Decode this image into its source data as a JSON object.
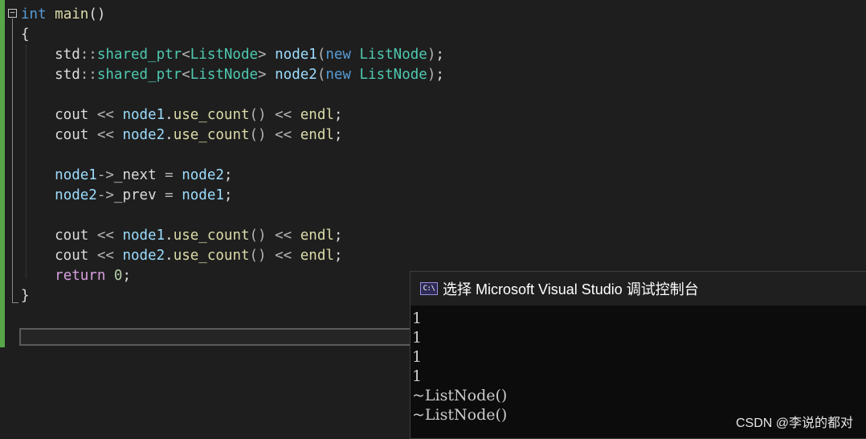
{
  "editor": {
    "lines": [
      [
        [
          "kw",
          "int"
        ],
        [
          "plain",
          " "
        ],
        [
          "fn",
          "main"
        ],
        [
          "plain",
          "()"
        ]
      ],
      [
        [
          "plain",
          "{"
        ]
      ],
      [
        [
          "plain",
          "    std"
        ],
        [
          "op",
          "::"
        ],
        [
          "ty",
          "shared_ptr"
        ],
        [
          "op",
          "<"
        ],
        [
          "ty",
          "ListNode"
        ],
        [
          "op",
          "> "
        ],
        [
          "var",
          "node1"
        ],
        [
          "op",
          "("
        ],
        [
          "kw",
          "new"
        ],
        [
          "plain",
          " "
        ],
        [
          "ty",
          "ListNode"
        ],
        [
          "op",
          ")"
        ],
        [
          "plain",
          ";"
        ]
      ],
      [
        [
          "plain",
          "    std"
        ],
        [
          "op",
          "::"
        ],
        [
          "ty",
          "shared_ptr"
        ],
        [
          "op",
          "<"
        ],
        [
          "ty",
          "ListNode"
        ],
        [
          "op",
          "> "
        ],
        [
          "var",
          "node2"
        ],
        [
          "op",
          "("
        ],
        [
          "kw",
          "new"
        ],
        [
          "plain",
          " "
        ],
        [
          "ty",
          "ListNode"
        ],
        [
          "op",
          ")"
        ],
        [
          "plain",
          ";"
        ]
      ],
      [],
      [
        [
          "plain",
          "    cout "
        ],
        [
          "op",
          "<<"
        ],
        [
          "plain",
          " "
        ],
        [
          "var",
          "node1"
        ],
        [
          "plain",
          "."
        ],
        [
          "fn",
          "use_count"
        ],
        [
          "op",
          "()"
        ],
        [
          "plain",
          " "
        ],
        [
          "op",
          "<<"
        ],
        [
          "plain",
          " "
        ],
        [
          "fn",
          "endl"
        ],
        [
          "plain",
          ";"
        ]
      ],
      [
        [
          "plain",
          "    cout "
        ],
        [
          "op",
          "<<"
        ],
        [
          "plain",
          " "
        ],
        [
          "var",
          "node2"
        ],
        [
          "plain",
          "."
        ],
        [
          "fn",
          "use_count"
        ],
        [
          "op",
          "()"
        ],
        [
          "plain",
          " "
        ],
        [
          "op",
          "<<"
        ],
        [
          "plain",
          " "
        ],
        [
          "fn",
          "endl"
        ],
        [
          "plain",
          ";"
        ]
      ],
      [],
      [
        [
          "plain",
          "    "
        ],
        [
          "var",
          "node1"
        ],
        [
          "op",
          "->"
        ],
        [
          "plain",
          "_next "
        ],
        [
          "op",
          "="
        ],
        [
          "plain",
          " "
        ],
        [
          "var",
          "node2"
        ],
        [
          "plain",
          ";"
        ]
      ],
      [
        [
          "plain",
          "    "
        ],
        [
          "var",
          "node2"
        ],
        [
          "op",
          "->"
        ],
        [
          "plain",
          "_prev "
        ],
        [
          "op",
          "="
        ],
        [
          "plain",
          " "
        ],
        [
          "var",
          "node1"
        ],
        [
          "plain",
          ";"
        ]
      ],
      [],
      [
        [
          "plain",
          "    cout "
        ],
        [
          "op",
          "<<"
        ],
        [
          "plain",
          " "
        ],
        [
          "var",
          "node1"
        ],
        [
          "plain",
          "."
        ],
        [
          "fn",
          "use_count"
        ],
        [
          "op",
          "()"
        ],
        [
          "plain",
          " "
        ],
        [
          "op",
          "<<"
        ],
        [
          "plain",
          " "
        ],
        [
          "fn",
          "endl"
        ],
        [
          "plain",
          ";"
        ]
      ],
      [
        [
          "plain",
          "    cout "
        ],
        [
          "op",
          "<<"
        ],
        [
          "plain",
          " "
        ],
        [
          "var",
          "node2"
        ],
        [
          "plain",
          "."
        ],
        [
          "fn",
          "use_count"
        ],
        [
          "op",
          "()"
        ],
        [
          "plain",
          " "
        ],
        [
          "op",
          "<<"
        ],
        [
          "plain",
          " "
        ],
        [
          "fn",
          "endl"
        ],
        [
          "plain",
          ";"
        ]
      ],
      [
        [
          "plain",
          "    "
        ],
        [
          "ret",
          "return"
        ],
        [
          "plain",
          " "
        ],
        [
          "num",
          "0"
        ],
        [
          "plain",
          ";"
        ]
      ],
      [
        [
          "plain",
          "}"
        ]
      ]
    ],
    "fold_glyph": "−"
  },
  "console": {
    "icon_text": "C:\\",
    "title": "选择 Microsoft Visual Studio 调试控制台",
    "output_lines": [
      "1",
      "1",
      "1",
      "1",
      "~ListNode()",
      "~ListNode()"
    ]
  },
  "watermark": "CSDN @李说的都对",
  "colors": {
    "keyword": "#569cd6",
    "function": "#dcdcaa",
    "type": "#4ec9b0",
    "variable": "#9cdcfe",
    "number": "#b5cea8",
    "control": "#d8a0df",
    "gutter_change": "#57a64a"
  }
}
